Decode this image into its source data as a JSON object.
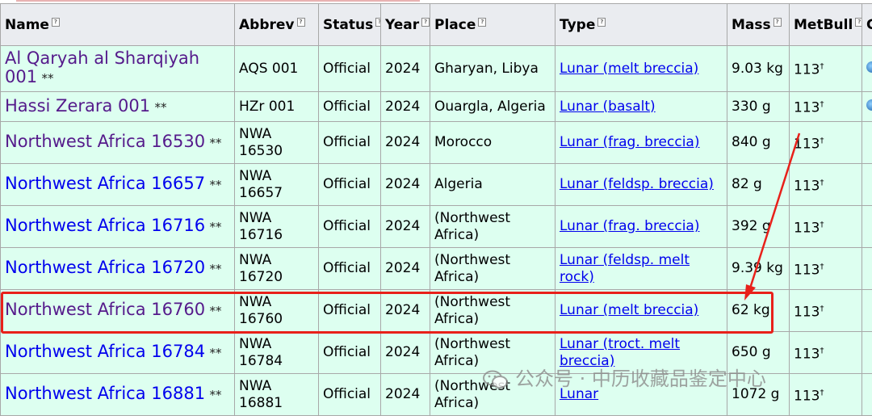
{
  "columns": [
    {
      "label": "Name"
    },
    {
      "label": "Abbrev"
    },
    {
      "label": "Status"
    },
    {
      "label": "Year"
    },
    {
      "label": "Place"
    },
    {
      "label": "Type"
    },
    {
      "label": "Mass"
    },
    {
      "label": "MetBull"
    },
    {
      "label": "G"
    }
  ],
  "rows": [
    {
      "name": "Al Qaryah al Sharqiyah 001",
      "stars": "**",
      "abbrev": "AQS 001",
      "status": "Official",
      "year": "2024",
      "place": "Gharyan, Libya",
      "type": "Lunar (melt breccia)",
      "mass": "9.03 kg",
      "metbull": "113",
      "dagger": "†",
      "globe": true,
      "visited": true
    },
    {
      "name": "Hassi Zerara 001",
      "stars": "**",
      "abbrev": "HZr 001",
      "status": "Official",
      "year": "2024",
      "place": "Ouargla, Algeria",
      "type": "Lunar (basalt)",
      "mass": "330 g",
      "metbull": "113",
      "dagger": "†",
      "globe": true,
      "visited": true
    },
    {
      "name": "Northwest Africa 16530",
      "stars": "**",
      "abbrev": "NWA 16530",
      "status": "Official",
      "year": "2024",
      "place": "Morocco",
      "type": "Lunar (frag. breccia)",
      "mass": "840 g",
      "metbull": "113",
      "dagger": "†",
      "globe": false,
      "visited": true
    },
    {
      "name": "Northwest Africa 16657",
      "stars": "**",
      "abbrev": "NWA 16657",
      "status": "Official",
      "year": "2024",
      "place": "Algeria",
      "type": "Lunar (feldsp. breccia)",
      "mass": "82 g",
      "metbull": "113",
      "dagger": "†",
      "globe": false,
      "visited": false
    },
    {
      "name": "Northwest Africa 16716",
      "stars": "**",
      "abbrev": "NWA 16716",
      "status": "Official",
      "year": "2024",
      "place": "(Northwest Africa)",
      "type": "Lunar (frag. breccia)",
      "mass": "392 g",
      "metbull": "113",
      "dagger": "†",
      "globe": false,
      "visited": false
    },
    {
      "name": "Northwest Africa 16720",
      "stars": "**",
      "abbrev": "NWA 16720",
      "status": "Official",
      "year": "2024",
      "place": "(Northwest Africa)",
      "type": "Lunar (feldsp. melt rock)",
      "mass": "9.39 kg",
      "metbull": "113",
      "dagger": "†",
      "globe": false,
      "visited": false
    },
    {
      "name": "Northwest Africa 16760",
      "stars": "**",
      "abbrev": "NWA 16760",
      "status": "Official",
      "year": "2024",
      "place": "(Northwest Africa)",
      "type": "Lunar (melt breccia)",
      "mass": "62 kg",
      "metbull": "113",
      "dagger": "†",
      "globe": false,
      "visited": true
    },
    {
      "name": "Northwest Africa 16784",
      "stars": "**",
      "abbrev": "NWA 16784",
      "status": "Official",
      "year": "2024",
      "place": "(Northwest Africa)",
      "type": "Lunar (troct. melt breccia)",
      "mass": "650 g",
      "metbull": "113",
      "dagger": "†",
      "globe": false,
      "visited": false
    },
    {
      "name": "Northwest Africa 16881",
      "stars": "**",
      "abbrev": "NWA 16881",
      "status": "Official",
      "year": "2024",
      "place": "(Northwest Africa)",
      "type": "Lunar",
      "mass": "1072 g",
      "metbull": "113",
      "dagger": "†",
      "globe": false,
      "visited": false
    }
  ],
  "watermark": "公众号 · 中历收藏品鉴定中心",
  "colors": {
    "highlight": "#e8201a",
    "link": "#0000ee",
    "visited": "#551a8b",
    "row_bg": "#ddfff0",
    "header_bg": "#eaecf0"
  }
}
